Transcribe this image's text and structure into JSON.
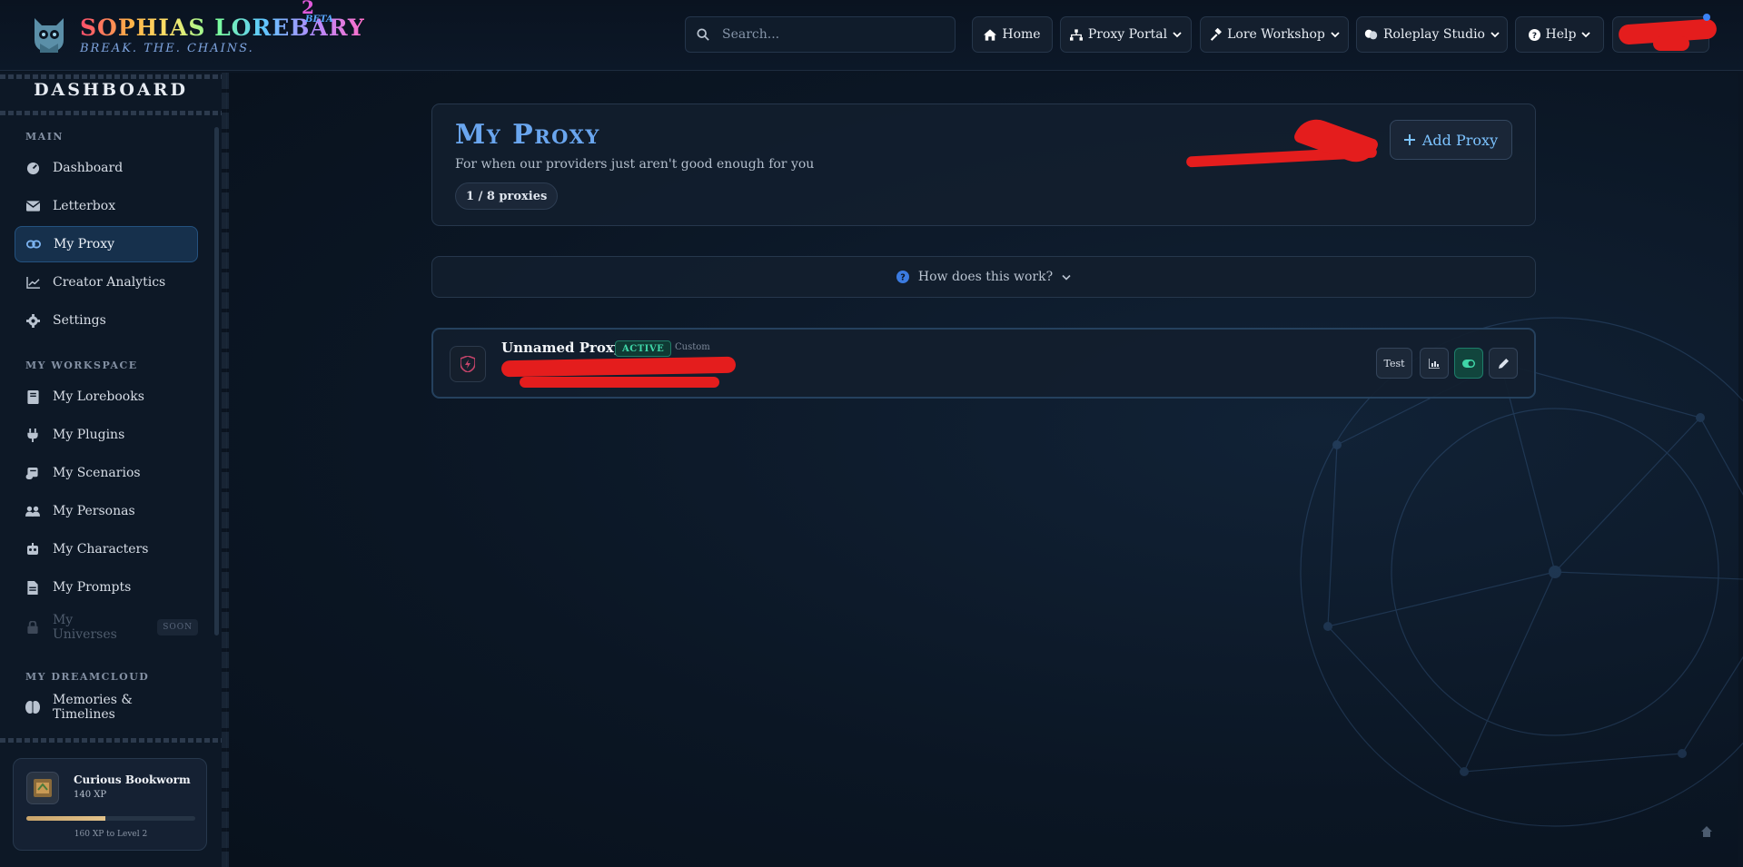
{
  "brand": {
    "name": "SOPHIAS LOREBARY",
    "superscript": "2",
    "beta": "BETA",
    "tagline": "BREAK. THE. CHAINS."
  },
  "search": {
    "placeholder": "Search..."
  },
  "nav": {
    "home": "Home",
    "proxy_portal": "Proxy Portal",
    "lore_workshop": "Lore Workshop",
    "roleplay_studio": "Roleplay Studio",
    "help": "Help"
  },
  "sidebar": {
    "title": "DASHBOARD",
    "sections": {
      "main": "MAIN",
      "workspace": "MY WORKSPACE",
      "dreamcloud": "MY DREAMCLOUD"
    },
    "items": {
      "dashboard": "Dashboard",
      "letterbox": "Letterbox",
      "my_proxy": "My Proxy",
      "creator_analytics": "Creator Analytics",
      "settings": "Settings",
      "lorebooks": "My Lorebooks",
      "plugins": "My Plugins",
      "scenarios": "My Scenarios",
      "personas": "My Personas",
      "characters": "My Characters",
      "prompts": "My Prompts",
      "universes": "My Universes",
      "memories": "Memories & Timelines"
    },
    "soon_label": "SOON",
    "active_item": "my_proxy"
  },
  "xp": {
    "title": "Curious Bookworm",
    "value": "140 XP",
    "progress": 0.47,
    "next": "160 XP to Level 2"
  },
  "page": {
    "title": "My Proxy",
    "subtitle": "For when our providers just aren't good enough for you",
    "count": "1 / 8 proxies",
    "add_button": "Add Proxy",
    "howto": "How does this work?"
  },
  "proxies": [
    {
      "name": "Unnamed Proxy",
      "status": "ACTIVE",
      "type": "Custom",
      "test_label": "Test",
      "enabled": true
    }
  ],
  "colors": {
    "accent": "#6aa6ef",
    "active_green": "#3fd6a8",
    "redaction": "#e41d1d"
  }
}
